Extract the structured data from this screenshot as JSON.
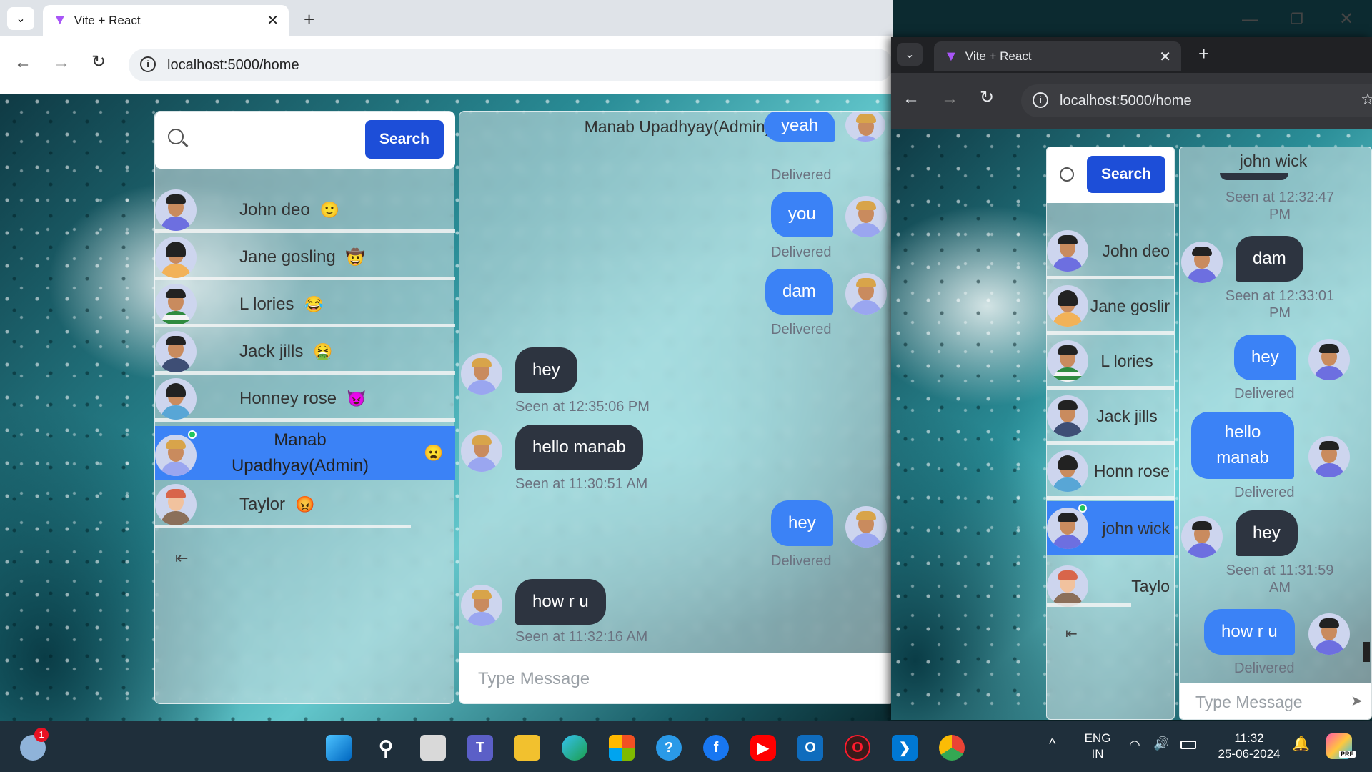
{
  "browser_left": {
    "tab_title": "Vite + React",
    "url": "localhost:5000/home"
  },
  "browser_right": {
    "tab_title": "Vite + React",
    "url": "localhost:5000/home"
  },
  "left_app": {
    "search_button": "Search",
    "users": [
      {
        "name": "John deo",
        "emoji": "🙂"
      },
      {
        "name": "Jane gosling",
        "emoji": "🤠"
      },
      {
        "name": "L lories",
        "emoji": "😂"
      },
      {
        "name": "Jack jills",
        "emoji": "🤮"
      },
      {
        "name": "Honney rose",
        "emoji": "😈"
      },
      {
        "name": "Manab Upadhyay(Admin)",
        "emoji": "😦",
        "selected": true
      },
      {
        "name": "Taylor",
        "emoji": "😡"
      }
    ],
    "chat_title": "Manab Upadhyay(Admin)",
    "messages": [
      {
        "text": "yeah",
        "from": "me",
        "status": "Delivered"
      },
      {
        "text": "you",
        "from": "me",
        "status": "Delivered"
      },
      {
        "text": "dam",
        "from": "me",
        "status": "Delivered"
      },
      {
        "text": "hey",
        "from": "them",
        "status": "Seen at 12:35:06 PM"
      },
      {
        "text": "hello manab",
        "from": "them",
        "status": "Seen at 11:30:51 AM"
      },
      {
        "text": "hey",
        "from": "me",
        "status": "Delivered"
      },
      {
        "text": "how r u",
        "from": "them",
        "status": "Seen at 11:32:16 AM"
      }
    ],
    "message_placeholder": "Type Message"
  },
  "right_app": {
    "search_button": "Search",
    "users": [
      {
        "name": "John deo"
      },
      {
        "name": "Jane goslir"
      },
      {
        "name": "L lories"
      },
      {
        "name": "Jack jills"
      },
      {
        "name": "Honn rose"
      },
      {
        "name": "john wick",
        "selected": true
      },
      {
        "name": "Taylo"
      }
    ],
    "chat_title": "john wick",
    "messages": [
      {
        "status": "Seen at 12:32:47 PM"
      },
      {
        "text": "dam",
        "from": "them",
        "status": "Seen at 12:33:01 PM"
      },
      {
        "text": "hey",
        "from": "me",
        "status": "Delivered"
      },
      {
        "text": "hello manab",
        "from": "me",
        "status": "Delivered"
      },
      {
        "text": "hey",
        "from": "them",
        "status": "Seen at 11:31:59 AM"
      },
      {
        "text": "how r u",
        "from": "me",
        "status": "Delivered"
      }
    ],
    "message_placeholder": "Type Message"
  },
  "taskbar": {
    "weather_badge": "1",
    "lang_top": "ENG",
    "lang_bottom": "IN",
    "time": "11:32",
    "date": "25-06-2024",
    "pre_badge": "PRE"
  }
}
